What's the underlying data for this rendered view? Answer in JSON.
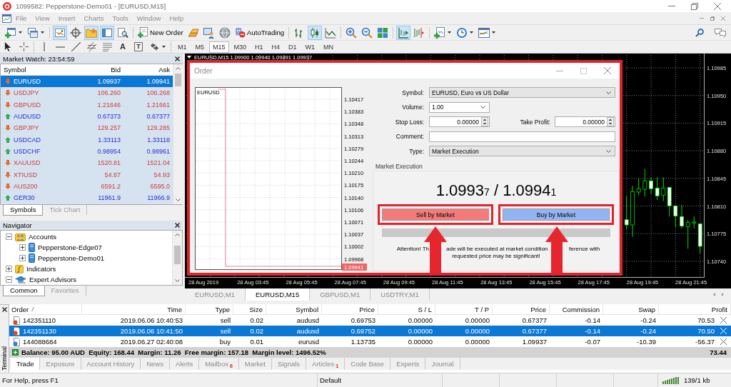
{
  "title_bar": {
    "title": "1099582: Pepperstone-Demo01 - [EURUSD,M15]"
  },
  "menu": [
    "File",
    "View",
    "Insert",
    "Charts",
    "Tools",
    "Window",
    "Help"
  ],
  "toolbar": {
    "panels": [
      {
        "on": true
      },
      {
        "on": false
      },
      {
        "on": true
      },
      {
        "on": true
      },
      {
        "on": false
      }
    ],
    "new_order": "New Order",
    "auto_trading": "AutoTrading",
    "chart_types": [
      {
        "selected": false
      },
      {
        "selected": true
      },
      {
        "selected": false
      }
    ],
    "auto_scroll": {
      "on": true
    },
    "chart_shift": {
      "on": false
    },
    "text_tool": "A",
    "label_tool": "T",
    "timeframes": [
      {
        "label": "M1",
        "selected": false
      },
      {
        "label": "M5",
        "selected": false
      },
      {
        "label": "M15",
        "selected": true
      },
      {
        "label": "M30",
        "selected": false
      },
      {
        "label": "H1",
        "selected": false
      },
      {
        "label": "H4",
        "selected": false
      },
      {
        "label": "D1",
        "selected": false
      },
      {
        "label": "W1",
        "selected": false
      },
      {
        "label": "MN",
        "selected": false
      }
    ]
  },
  "market_watch": {
    "title": "Market Watch: 23:54:59",
    "columns": [
      "Symbol",
      "Bid",
      "Ask"
    ],
    "rows": [
      {
        "symbol": "EURUSD",
        "bid": "1.09937",
        "ask": "1.09941",
        "rising": false,
        "selected": true
      },
      {
        "symbol": "USDJPY",
        "bid": "106.260",
        "ask": "106.268",
        "rising": false,
        "selected": false
      },
      {
        "symbol": "GBPUSD",
        "bid": "1.21646",
        "ask": "1.21661",
        "rising": false,
        "selected": false
      },
      {
        "symbol": "AUDUSD",
        "bid": "0.67373",
        "ask": "0.67377",
        "rising": true,
        "selected": false
      },
      {
        "symbol": "GBPJPY",
        "bid": "129.257",
        "ask": "129.285",
        "rising": false,
        "selected": false
      },
      {
        "symbol": "USDCAD",
        "bid": "1.33113",
        "ask": "1.33118",
        "rising": true,
        "selected": false
      },
      {
        "symbol": "USDCHF",
        "bid": "0.98954",
        "ask": "0.98961",
        "rising": true,
        "selected": false
      },
      {
        "symbol": "XAUUSD",
        "bid": "1520.81",
        "ask": "1521.04",
        "rising": false,
        "selected": false
      },
      {
        "symbol": "XTIUSD",
        "bid": "54.87",
        "ask": "54.93",
        "rising": false,
        "selected": false
      },
      {
        "symbol": "AUS200",
        "bid": "6591.2",
        "ask": "6595.0",
        "rising": false,
        "selected": false
      },
      {
        "symbol": "GER30",
        "bid": "11961.9",
        "ask": "11966.9",
        "rising": true,
        "selected": false
      }
    ],
    "tabs": [
      {
        "label": "Symbols",
        "selected": true
      },
      {
        "label": "Tick Chart",
        "selected": false
      }
    ]
  },
  "navigator": {
    "title": "Navigator",
    "tree": [
      {
        "label": "Accounts",
        "kind": "accounts",
        "expanded": true,
        "children": [
          {
            "label": "Pepperstone-Edge07",
            "kind": "account",
            "expanded": false
          },
          {
            "label": "Pepperstone-Demo01",
            "kind": "account",
            "expanded": false
          }
        ]
      },
      {
        "label": "Indicators",
        "kind": "indicators",
        "expanded": false
      },
      {
        "label": "Expert Advisors",
        "kind": "experts",
        "expanded": true
      }
    ],
    "tabs": [
      {
        "label": "Common",
        "selected": true
      },
      {
        "label": "Favorites",
        "selected": false
      }
    ]
  },
  "chart": {
    "header": "EURUSD,M15  1.09900 1.09940 1.09891 1.09937",
    "price_labels": [
      "1.10985",
      "1.10950",
      "1.10915",
      "1.10880",
      "1.10845",
      "1.10810",
      "1.10775",
      "1.10740"
    ],
    "time_labels": [
      "28 Aug 2019",
      "28 Aug 03:45",
      "28 Aug 05:45",
      "28 Aug 07:45",
      "28 Aug 09:45",
      "28 Aug 11:45",
      "28 Aug 13:45",
      "28 Aug 15:45",
      "28 Aug 17:45",
      "28 Aug 19:45",
      "28 Aug 21:45"
    ]
  },
  "order_dialog": {
    "title": "Order",
    "chart_symbol": "EURUSD",
    "chart_prices": [
      "1.10417",
      "1.10383",
      "1.10348",
      "1.10313",
      "1.10279",
      "1.10244",
      "1.10210",
      "1.10175",
      "1.10140",
      "1.10106",
      "1.10071",
      "1.10037",
      "1.10002",
      "1.09968"
    ],
    "current_price": "1.09941",
    "symbol": {
      "label": "Symbol:",
      "value": "EURUSD, Euro vs US Dollar"
    },
    "volume": {
      "label": "Volume:",
      "value": "1.00"
    },
    "stop_loss": {
      "label": "Stop Loss:",
      "value": "0.00000"
    },
    "take_profit": {
      "label": "Take Profit:",
      "value": "0.00000"
    },
    "comment": {
      "label": "Comment:"
    },
    "type": {
      "label": "Type:",
      "value": "Market Execution"
    },
    "section": "Market Execution",
    "quote": "1.0993$_{7}$ / 1.0994$_{1}$",
    "sell_button": "Sell by Market",
    "buy_button": "Buy by Market",
    "notice": {
      "line_1": [
        "Attention! Th",
        "ade will be executed at market condition",
        "ference with"
      ],
      "line_2": "requested price may be significant!"
    }
  },
  "chart_tabs": [
    {
      "label": "EURUSD,M1",
      "selected": false
    },
    {
      "label": "EURUSD,M15",
      "selected": true
    },
    {
      "label": "GBPUSD,M1",
      "selected": false
    },
    {
      "label": "USDTRY,M1",
      "selected": false
    }
  ],
  "terminal": {
    "title": "Terminal",
    "columns": [
      {
        "label": "Order",
        "sorted": true
      },
      {
        "label": "Time",
        "sorted": false
      },
      {
        "label": "Type",
        "sorted": false
      },
      {
        "label": "Size",
        "sorted": false
      },
      {
        "label": "Symbol",
        "sorted": false
      },
      {
        "label": "Price",
        "sorted": false
      },
      {
        "label": "S / L",
        "sorted": false
      },
      {
        "label": "T / P",
        "sorted": false
      },
      {
        "label": "Price",
        "sorted": false
      },
      {
        "label": "Commission",
        "sorted": false
      },
      {
        "label": "Swap",
        "sorted": false
      },
      {
        "label": "Profit",
        "sorted": false
      }
    ],
    "rows": [
      {
        "kind": "sell",
        "order": "142351110",
        "time": "2019.06.06 10:40:53",
        "type": "sell",
        "size": "0.02",
        "symbol": "audusd",
        "price": "0.69753",
        "sl": "0.00000",
        "tp": "0.00000",
        "current_price": "0.67377",
        "commission": "-0.14",
        "swap": "-0.24",
        "profit": "70.53",
        "selected": false
      },
      {
        "kind": "sell",
        "order": "142351130",
        "time": "2019.06.06 10:41:50",
        "type": "sell",
        "size": "0.02",
        "symbol": "audusd",
        "price": "0.69752",
        "sl": "0.00000",
        "tp": "0.00000",
        "current_price": "0.67377",
        "commission": "-0.14",
        "swap": "-0.24",
        "profit": "70.50",
        "selected": true
      },
      {
        "kind": "buy",
        "order": "144088684",
        "time": "2019.06.27 02:40:08",
        "type": "buy",
        "size": "0.01",
        "symbol": "eurusd",
        "price": "1.13735",
        "sl": "0.00000",
        "tp": "0.00000",
        "current_price": "1.09937",
        "commission": "-0.07",
        "swap": "-10.39",
        "profit": "-56.37",
        "selected": false
      }
    ],
    "summary": "Balance: 95.00 AUD  Equity: 168.44  Margin: 11.26  Free margin: 157.18  Margin level: 1496.52%",
    "total_profit": "73.44",
    "tabs": [
      {
        "label": "Trade",
        "selected": true
      },
      {
        "label": "Exposure",
        "selected": false
      },
      {
        "label": "Account History",
        "selected": false
      },
      {
        "label": "News",
        "selected": false
      },
      {
        "label": "Alerts",
        "selected": false
      },
      {
        "label": "Mailbox",
        "badge": "6",
        "selected": false
      },
      {
        "label": "Market",
        "selected": false
      },
      {
        "label": "Signals",
        "selected": false
      },
      {
        "label": "Articles",
        "badge": "1",
        "selected": false
      },
      {
        "label": "Code Base",
        "selected": false
      },
      {
        "label": "Experts",
        "selected": false
      },
      {
        "label": "Journal",
        "selected": false
      }
    ]
  },
  "status_bar": {
    "help": "For Help, press F1",
    "profile": "Default",
    "traffic": "139/1 kb"
  }
}
